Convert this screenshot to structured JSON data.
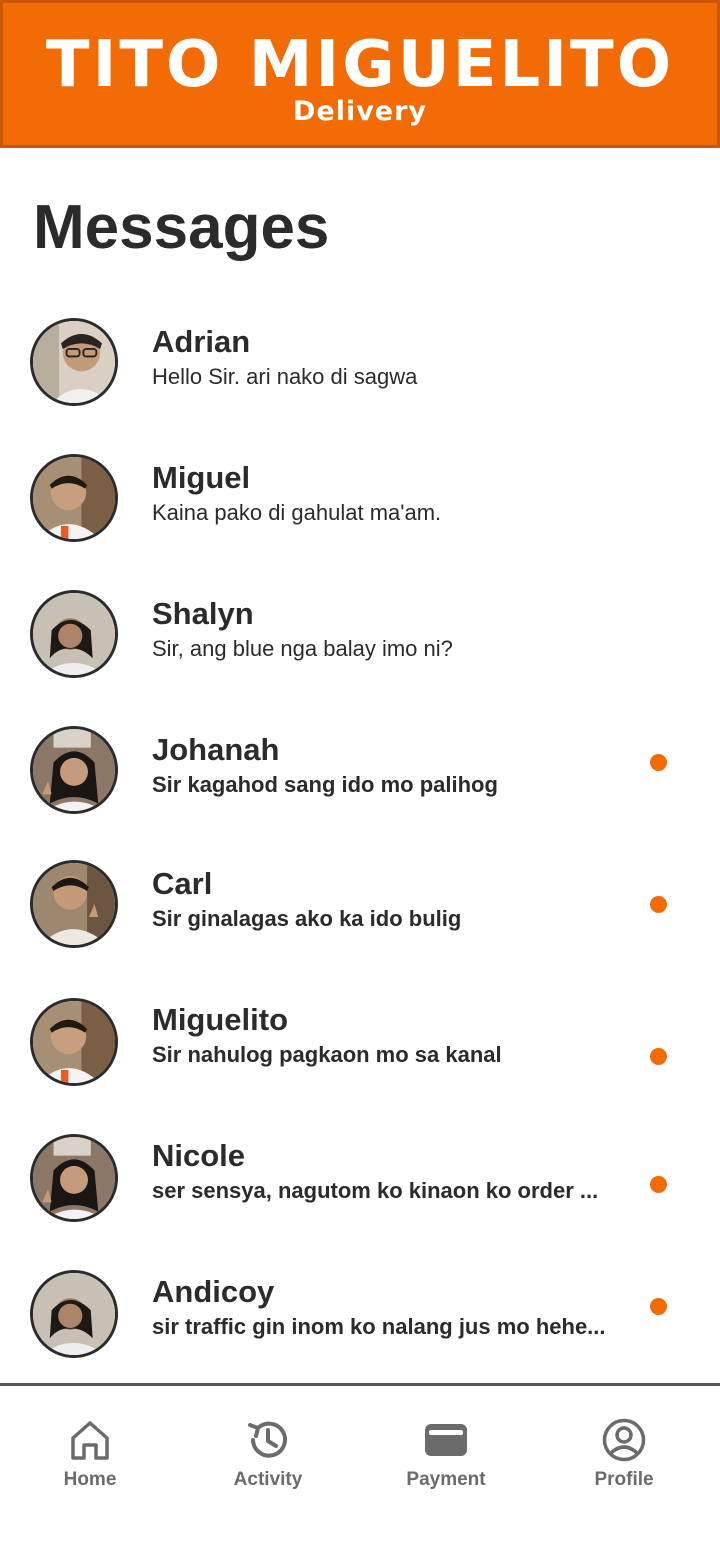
{
  "header": {
    "brand_title": "TITO MIGUELITO",
    "brand_subtitle": "Delivery",
    "background_color": "#f26b05"
  },
  "page_title": "Messages",
  "messages": [
    {
      "name": "Adrian",
      "preview": "Hello Sir. ari nako di sagwa",
      "unread": false,
      "avatar_tone": "#8b7a66"
    },
    {
      "name": "Miguel",
      "preview": "Kaina pako di gahulat ma'am.",
      "unread": false,
      "avatar_tone": "#6e5a48"
    },
    {
      "name": "Shalyn",
      "preview": "Sir, ang blue nga balay imo ni?",
      "unread": false,
      "avatar_tone": "#a09486"
    },
    {
      "name": "Johanah",
      "preview": "Sir kagahod sang ido mo palihog",
      "unread": true,
      "avatar_tone": "#7d6a5c"
    },
    {
      "name": "Carl",
      "preview": "Sir ginalagas ako ka ido bulig",
      "unread": true,
      "avatar_tone": "#857260"
    },
    {
      "name": "Miguelito",
      "preview": "Sir nahulog pagkaon mo sa kanal",
      "unread": true,
      "avatar_tone": "#6e5a48"
    },
    {
      "name": "Nicole",
      "preview": "ser sensya, nagutom ko kinaon ko order ...",
      "unread": true,
      "avatar_tone": "#7d6a5c"
    },
    {
      "name": "Andicoy",
      "preview": "sir traffic gin inom ko nalang jus mo hehe...",
      "unread": true,
      "avatar_tone": "#a09486"
    }
  ],
  "nav": {
    "home": "Home",
    "activity": "Activity",
    "payment": "Payment",
    "profile": "Profile"
  },
  "colors": {
    "accent": "#f26b05",
    "text": "#2b2b2b",
    "nav_text": "#6b6b6b"
  }
}
